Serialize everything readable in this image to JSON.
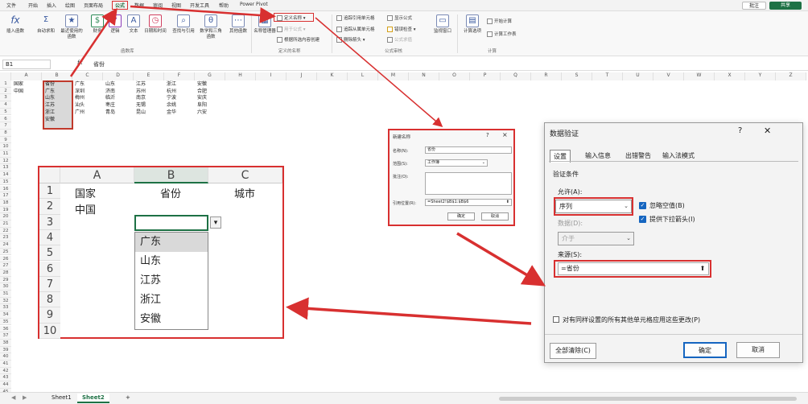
{
  "menu": {
    "tabs": [
      "文件",
      "开始",
      "插入",
      "绘图",
      "页面布局",
      "公式",
      "数据",
      "审阅",
      "视图",
      "开发工具",
      "帮助",
      "Power Pivot"
    ],
    "comment": "批注",
    "share": "共享"
  },
  "ribbon": {
    "insert_fn": "插入函数",
    "autosum": "自动求和",
    "recent": "最近使用的函数",
    "financial": "财务",
    "logical": "逻辑",
    "text": "文本",
    "datetime": "日期和时间",
    "lookup": "查找与引用",
    "math": "数学和三角函数",
    "other": "其他函数",
    "group_lib": "函数库",
    "name_mgr": "名称管理器",
    "define_name": "定义名称",
    "use_in_formula": "用于公式",
    "create_from_sel": "根据所选内容创建",
    "group_names": "定义的名称",
    "trace_prec": "追踪引用单元格",
    "trace_dep": "追踪从属单元格",
    "remove_arrows": "删除箭头",
    "show_formulas": "显示公式",
    "error_check": "错误检查",
    "eval_formula": "公式求值",
    "group_audit": "公式审核",
    "watch": "监视窗口",
    "calc_options": "计算选项",
    "calc_now": "开始计算",
    "calc_sheet": "计算工作表",
    "group_calc": "计算"
  },
  "formula_bar": {
    "cell": "B1",
    "fx": "fx",
    "value": "省份"
  },
  "sheet": {
    "col_headers": [
      "A",
      "B",
      "C",
      "D",
      "E",
      "F",
      "G",
      "H",
      "I",
      "J",
      "K",
      "L",
      "M",
      "N",
      "O",
      "P",
      "Q",
      "R",
      "S",
      "T",
      "U",
      "V",
      "W",
      "X",
      "Y",
      "Z"
    ],
    "row_headers": [
      "1",
      "2",
      "3",
      "4",
      "5",
      "6",
      "7",
      "8",
      "9",
      "10",
      "11",
      "12",
      "13",
      "14",
      "15",
      "16",
      "17",
      "18",
      "19",
      "20",
      "21",
      "22",
      "23",
      "24",
      "25",
      "26",
      "27",
      "28",
      "29",
      "30",
      "31",
      "32",
      "33",
      "34",
      "35",
      "36",
      "37",
      "38",
      "39",
      "40",
      "41",
      "42",
      "43",
      "44",
      "45"
    ],
    "A1": "国家",
    "A2": "中国",
    "B": [
      "省份",
      "广东",
      "山东",
      "江苏",
      "浙江",
      "安徽"
    ],
    "table_rows": [
      [
        "广东",
        "山东",
        "江苏",
        "浙江",
        "安徽"
      ],
      [
        "深圳",
        "济南",
        "苏州",
        "杭州",
        "合肥"
      ],
      [
        "梅州",
        "临沂",
        "南京",
        "宁波",
        "安庆"
      ],
      [
        "汕头",
        "枣庄",
        "无锡",
        "余姚",
        "阜阳"
      ],
      [
        "广州",
        "青岛",
        "昆山",
        "金华",
        "六安"
      ]
    ]
  },
  "zoom": {
    "cols": [
      "A",
      "B",
      "C"
    ],
    "rows": [
      "1",
      "2",
      "3",
      "4",
      "5",
      "6",
      "7",
      "8",
      "9",
      "10"
    ],
    "A1": "国家",
    "B1": "省份",
    "C1": "城市",
    "A2": "中国",
    "dropdown_items": [
      "广东",
      "山东",
      "江苏",
      "浙江",
      "安徽"
    ]
  },
  "new_name_dialog": {
    "title": "新建名称",
    "name_label": "名称(N):",
    "name_value": "省份",
    "scope_label": "范围(S):",
    "scope_value": "工作簿",
    "comment_label": "批注(O):",
    "ref_label": "引用位置(R):",
    "ref_value": "=Sheet2!$B$1:$B$6",
    "ok": "确定",
    "cancel": "取消"
  },
  "dv_dialog": {
    "title": "数据验证",
    "tabs": [
      "设置",
      "输入信息",
      "出错警告",
      "输入法模式"
    ],
    "criteria": "验证条件",
    "allow_label": "允许(A):",
    "allow_value": "序列",
    "ignore_blank": "忽略空值(B)",
    "in_cell_dropdown": "提供下拉箭头(I)",
    "data_label": "数据(D):",
    "data_value": "介于",
    "source_label": "来源(S):",
    "source_value": "=省份",
    "apply_all": "对有同样设置的所有其他单元格应用这些更改(P)",
    "clear_all": "全部清除(C)",
    "ok": "确定",
    "cancel": "取消"
  },
  "status": {
    "sheets": [
      "Sheet1",
      "Sheet2"
    ],
    "add": "+"
  },
  "colors": {
    "accent": "#1e7145",
    "highlight": "#d83030"
  }
}
